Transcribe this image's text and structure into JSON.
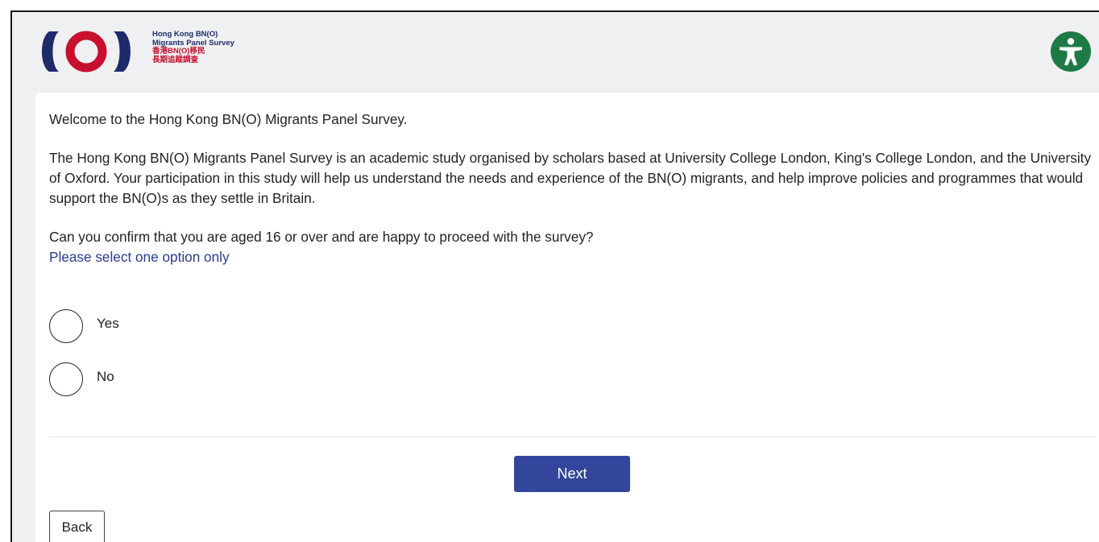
{
  "header": {
    "logo": {
      "en_line1": "Hong Kong BN(O)",
      "en_line2": "Migrants Panel Survey",
      "zh_line1": "香港BN(O)移民",
      "zh_line2": "長期追蹤調查"
    },
    "accessibility_icon": "accessibility-icon"
  },
  "colors": {
    "logo_navy": "#1f2a6b",
    "logo_red": "#c8102e",
    "accessibility_green": "#1d7a45",
    "primary_button": "#34469b",
    "instruction_text": "#2b3a8f"
  },
  "survey": {
    "welcome": "Welcome to the Hong Kong BN(O) Migrants Panel Survey.",
    "intro": "The Hong Kong BN(O) Migrants Panel Survey is an academic study organised by scholars based at University College London, King's College London, and the University of Oxford. Your participation in this study will help us understand the needs and experience of the BN(O) migrants, and help improve policies and programmes that would support the BN(O)s as they settle in Britain.",
    "question": "Can you confirm that you are aged 16 or over and are happy to proceed with the survey?",
    "instruction": "Please select one option only",
    "options": [
      {
        "label": "Yes",
        "selected": false
      },
      {
        "label": "No",
        "selected": false
      }
    ]
  },
  "buttons": {
    "next": "Next",
    "back": "Back"
  }
}
